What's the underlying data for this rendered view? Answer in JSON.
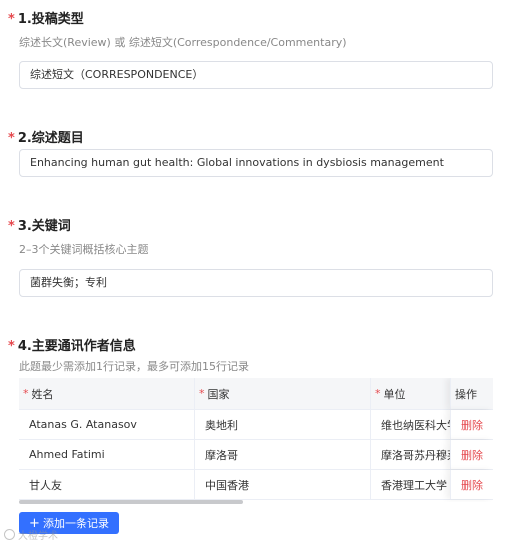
{
  "sections": [
    {
      "required_mark": "*",
      "title": "1.投稿类型",
      "hint": "综述长文(Review) 或 综述短文(Correspondence/Commentary)",
      "value": "综述短文（CORRESPONDENCE）"
    },
    {
      "required_mark": "*",
      "title": "2.综述题目",
      "value": "Enhancing human gut health: Global innovations in dysbiosis management"
    },
    {
      "required_mark": "*",
      "title": "3.关键词",
      "hint": "2–3个关键词概括核心主题",
      "value": "菌群失衡；专利"
    },
    {
      "required_mark": "*",
      "title": "4.主要通讯作者信息",
      "hint": "此题最少需添加1行记录，最多可添加15行记录"
    }
  ],
  "author_table": {
    "columns": [
      {
        "required_mark": "*",
        "label": "姓名"
      },
      {
        "required_mark": "*",
        "label": "国家"
      },
      {
        "required_mark": "*",
        "label": "单位"
      },
      {
        "label": "操作"
      }
    ],
    "rows": [
      {
        "name": "Atanas G. Atanasov",
        "country": "奥地利",
        "unit": "维也纳医科大学",
        "action": "删除"
      },
      {
        "name": "Ahmed Fatimi",
        "country": "摩洛哥",
        "unit": "摩洛哥苏丹穆莱·斯利曼大学",
        "action": "删除"
      },
      {
        "name": "甘人友",
        "country": "中国香港",
        "unit": "香港理工大学",
        "action": "删除"
      }
    ],
    "add_button_label": "添加一条记录",
    "add_button_icon": "+"
  },
  "watermark": "大橙学术"
}
